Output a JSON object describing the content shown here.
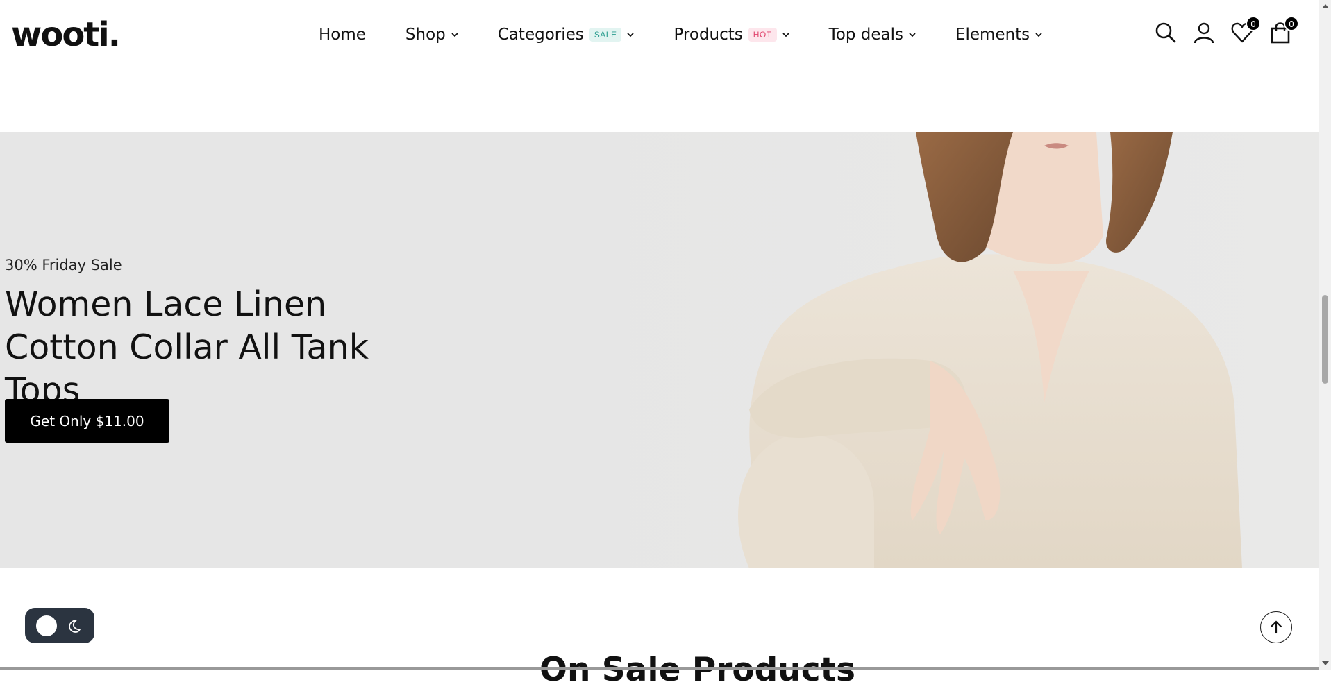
{
  "brand": {
    "logo": "wooti."
  },
  "nav": {
    "items": [
      {
        "label": "Home"
      },
      {
        "label": "Shop"
      },
      {
        "label": "Categories",
        "badge": "SALE"
      },
      {
        "label": "Products",
        "badge": "HOT"
      },
      {
        "label": "Top deals"
      },
      {
        "label": "Elements"
      }
    ]
  },
  "header_icons": {
    "search": "search-icon",
    "account": "user-icon",
    "wishlist": "heart-icon",
    "wishlist_count": "0",
    "cart": "shopping-bag-icon",
    "cart_count": "0"
  },
  "hero": {
    "subtitle": "30% Friday Sale",
    "title_line1": "Women Lace Linen",
    "title_line2": "Cotton Collar All Tank Tops",
    "cta_label": "Get Only $11.00"
  },
  "section": {
    "title": "On Sale Products"
  },
  "colors": {
    "accent": "#000000",
    "hero_bg": "#e6e6e6",
    "sale_badge": "#2a9d8f",
    "hot_badge": "#e0436c",
    "toggle_bg": "#2b3440"
  }
}
